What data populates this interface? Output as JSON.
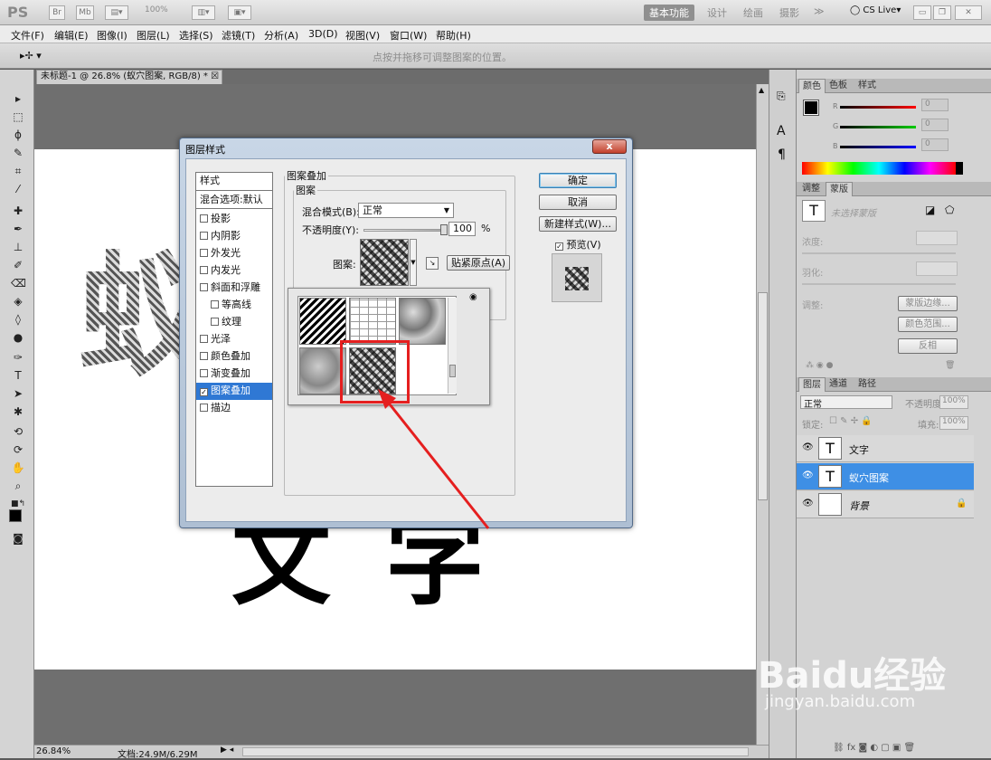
{
  "app": {
    "logo": "PS",
    "top_buttons": [
      "Br",
      "Mb"
    ],
    "zoom_display": "100%",
    "workspaces": [
      "基本功能",
      "设计",
      "绘画",
      "摄影"
    ],
    "more": "≫",
    "cslive": "CS Live"
  },
  "menu": [
    "文件(F)",
    "编辑(E)",
    "图像(I)",
    "图层(L)",
    "选择(S)",
    "滤镜(T)",
    "分析(A)",
    "3D(D)",
    "视图(V)",
    "窗口(W)",
    "帮助(H)"
  ],
  "options_hint": "点按并拖移可调整图案的位置。",
  "document_tab": "未标题-1 @ 26.8% (蚁穴图案, RGB/8) *",
  "canvas_text": {
    "upper": "蚁穴图案",
    "lower": "文字"
  },
  "status": {
    "zoom": "26.84%",
    "doc": "文档:24.9M/6.29M"
  },
  "dialog": {
    "title": "图层样式",
    "close": "x",
    "styles_header": "样式",
    "blend_default": "混合选项:默认",
    "style_items": [
      {
        "label": "投影",
        "checked": false
      },
      {
        "label": "内阴影",
        "checked": false
      },
      {
        "label": "外发光",
        "checked": false
      },
      {
        "label": "内发光",
        "checked": false
      },
      {
        "label": "斜面和浮雕",
        "checked": false
      },
      {
        "label": "等高线",
        "checked": false
      },
      {
        "label": "纹理",
        "checked": false
      },
      {
        "label": "光泽",
        "checked": false
      },
      {
        "label": "颜色叠加",
        "checked": false
      },
      {
        "label": "渐变叠加",
        "checked": false
      },
      {
        "label": "图案叠加",
        "checked": true
      },
      {
        "label": "描边",
        "checked": false
      }
    ],
    "section_title": "图案叠加",
    "group_title": "图案",
    "blend_mode_label": "混合模式(B):",
    "blend_mode_value": "正常",
    "opacity_label": "不透明度(Y):",
    "opacity_value": "100",
    "opacity_unit": "%",
    "opacity_level": 1.0,
    "pattern_label": "图案:",
    "snap_origin": "贴紧原点(A)",
    "buttons": {
      "ok": "确定",
      "cancel": "取消",
      "new_style": "新建样式(W)...",
      "preview": "预览(V)"
    },
    "preview_checked": true
  },
  "color_panel": {
    "tabs": [
      "颜色",
      "色板",
      "样式"
    ],
    "channels": [
      {
        "name": "R",
        "value": "0"
      },
      {
        "name": "G",
        "value": "0"
      },
      {
        "name": "B",
        "value": "0"
      }
    ]
  },
  "adjust_panel": {
    "tabs": [
      "调整",
      "蒙版"
    ],
    "no_selection": "未选择蒙版",
    "density": "浓度:",
    "feather": "羽化:",
    "refine": "调整:",
    "mask_edge": "蒙版边缘...",
    "color_range": "颜色范围...",
    "invert": "反相"
  },
  "layers_panel": {
    "tabs": [
      "图层",
      "通道",
      "路径"
    ],
    "blend": "正常",
    "opacity_label": "不透明度:",
    "opacity": "100%",
    "lock_label": "锁定:",
    "fill_label": "填充:",
    "fill": "100%",
    "layers": [
      {
        "name": "文字",
        "type": "T",
        "selected": false
      },
      {
        "name": "蚁穴图案",
        "type": "T",
        "selected": true
      },
      {
        "name": "背景",
        "type": "bg",
        "selected": false
      }
    ]
  },
  "watermark": {
    "brand": "Baidu经验",
    "url": "jingyan.baidu.com"
  },
  "colors": {
    "accent": "#e51f1f",
    "selection": "#3e8fe5"
  }
}
